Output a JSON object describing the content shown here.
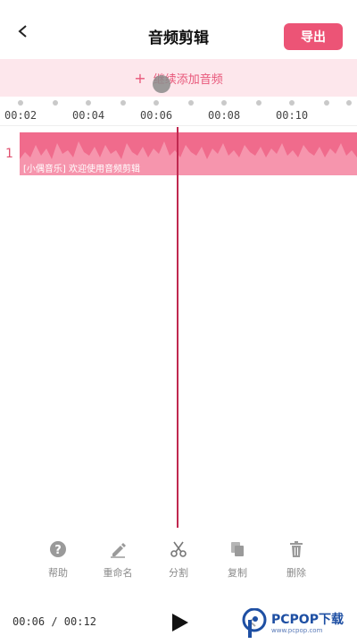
{
  "header": {
    "title": "音频剪辑",
    "export_label": "导出"
  },
  "add_bar": {
    "label": "继续添加音频",
    "plus": "+"
  },
  "ruler": {
    "labels": [
      "00:02",
      "00:04",
      "00:06",
      "00:08",
      "00:10"
    ]
  },
  "track": {
    "number": "1",
    "clip_label": "[小偶音乐] 欢迎使用音频剪辑"
  },
  "tools": {
    "help": "帮助",
    "rename": "重命名",
    "split": "分割",
    "copy": "复制",
    "delete": "删除"
  },
  "playback": {
    "time": "00:06 / 00:12"
  },
  "watermark": {
    "brand": "PCPOP下载",
    "sub": "www.pcpop.com"
  },
  "colors": {
    "accent": "#ec5476",
    "clip": "#f06b8c",
    "playhead": "#c0284f"
  }
}
